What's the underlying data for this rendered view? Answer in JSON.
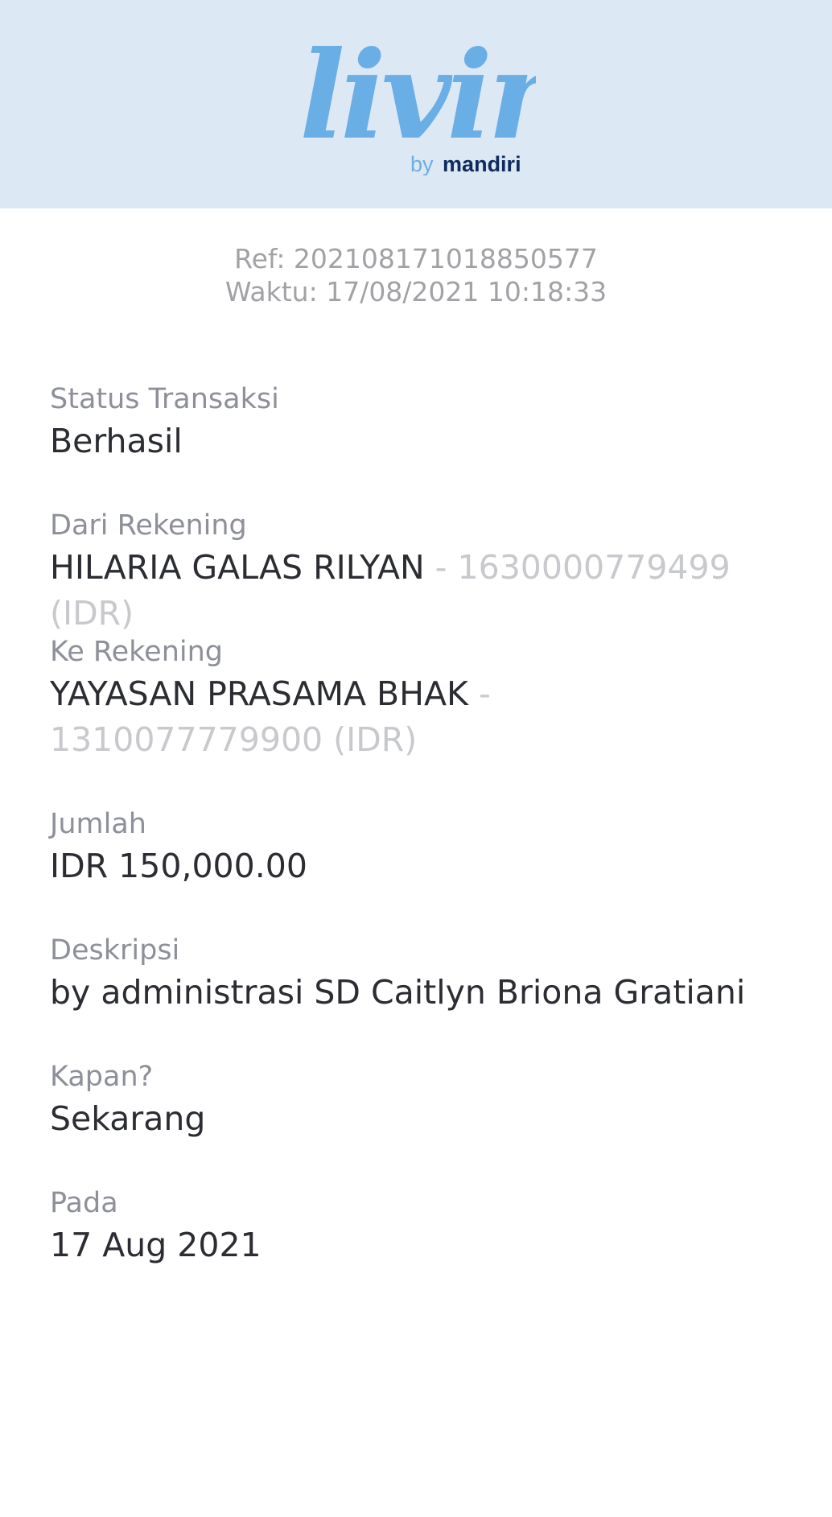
{
  "header": {
    "logo_text": "livin'",
    "logo_sub_by": "by",
    "logo_sub_brand": "mandiri",
    "colors": {
      "header_bg": "#dce8f4",
      "logo_blue": "#6aaee6",
      "logo_yellow": "#f6b01f",
      "mandiri_navy": "#0f2a5b"
    }
  },
  "meta": {
    "ref": "Ref: 202108171018850577",
    "time": "Waktu: 17/08/2021 10:18:33"
  },
  "fields": {
    "status": {
      "label": "Status Transaksi",
      "value": "Berhasil"
    },
    "from": {
      "label": "Dari Rekening",
      "name": "HILARIA GALAS RILYAN",
      "account": " - 1630000779499 (IDR)"
    },
    "to": {
      "label": "Ke Rekening",
      "name": "YAYASAN PRASAMA BHAK",
      "account": " - 1310077779900 (IDR)"
    },
    "amount": {
      "label": "Jumlah",
      "value": "IDR 150,000.00"
    },
    "description": {
      "label": "Deskripsi",
      "value": "by administrasi SD Caitlyn Briona Gratiani"
    },
    "when": {
      "label": "Kapan?",
      "value": "Sekarang"
    },
    "on": {
      "label": "Pada",
      "value": "17 Aug 2021"
    }
  }
}
